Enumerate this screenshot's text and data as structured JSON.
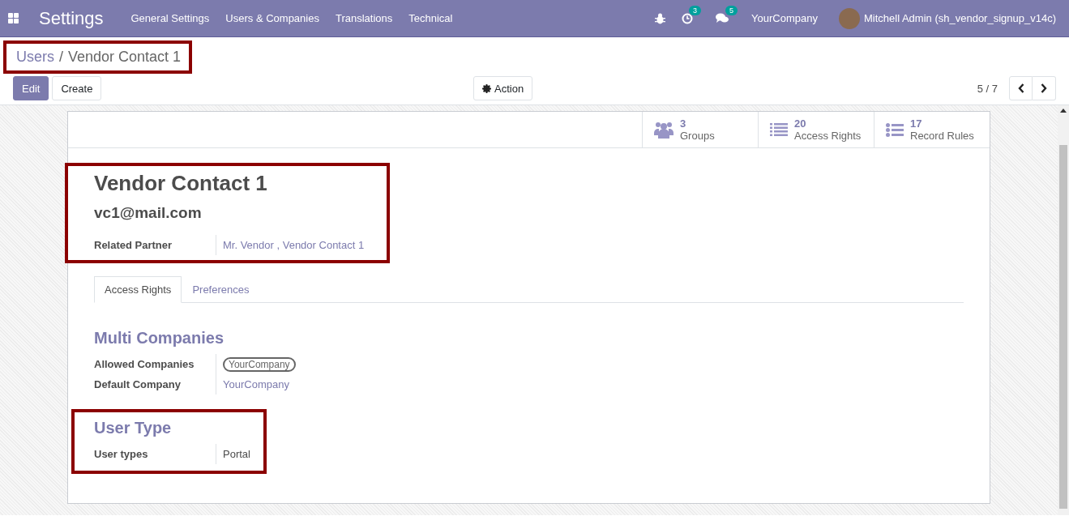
{
  "navbar": {
    "app_title": "Settings",
    "menus": [
      "General Settings",
      "Users & Companies",
      "Translations",
      "Technical"
    ],
    "activity_count": "3",
    "message_count": "5",
    "company": "YourCompany",
    "user": "Mitchell Admin (sh_vendor_signup_v14c)"
  },
  "breadcrumb": {
    "highlighted": true,
    "separator": "/",
    "items": [
      {
        "label": "Users"
      },
      {
        "label": "Vendor Contact 1"
      }
    ]
  },
  "buttons": {
    "edit": "Edit",
    "create": "Create",
    "action": "Action"
  },
  "pager": {
    "value": "5 / 7"
  },
  "smart_buttons": [
    {
      "kind": "groups",
      "value": "3",
      "label": "Groups"
    },
    {
      "kind": "list",
      "value": "20",
      "label": "Access Rights"
    },
    {
      "kind": "bullets",
      "value": "17",
      "label": "Record Rules"
    }
  ],
  "header": {
    "highlighted": true,
    "name": "Vendor Contact 1",
    "email": "vc1@mail.com",
    "fields": [
      {
        "label": "Related Partner",
        "value": "Mr. Vendor , Vendor Contact 1",
        "kind": "link"
      }
    ]
  },
  "tabs": [
    {
      "label": "Access Rights",
      "selected": true
    },
    {
      "label": "Preferences",
      "selected": false
    }
  ],
  "sections": [
    {
      "title": "Multi Companies",
      "highlighted": false,
      "fields": [
        {
          "label": "Allowed Companies",
          "value": "YourCompany",
          "kind": "tag"
        },
        {
          "label": "Default Company",
          "value": "YourCompany",
          "kind": "link"
        }
      ]
    },
    {
      "title": "User Type",
      "highlighted": true,
      "fields": [
        {
          "label": "User types",
          "value": "Portal",
          "kind": "text"
        }
      ]
    }
  ]
}
